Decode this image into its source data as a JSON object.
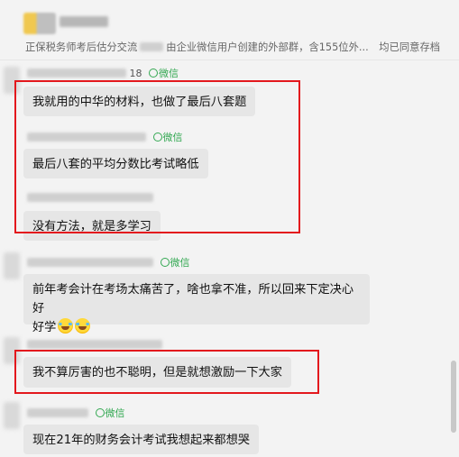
{
  "header": {
    "subtitle_prefix": "正保税务师考后估分交流",
    "subtitle_suffix": "由企业微信用户创建的外部群，含155位外...",
    "consent": "均已同意存档"
  },
  "wechat_tag": "微信",
  "messages": [
    {
      "sender_suffix": "18",
      "text": "我就用的中华的材料，也做了最后八套题"
    },
    {
      "sender_suffix": "",
      "text": "最后八套的平均分数比考试略低"
    },
    {
      "sender_suffix": "",
      "text": "没有方法，就是多学习"
    },
    {
      "sender_suffix": "",
      "text_line1": "前年考会计在考场太痛苦了，啥也拿不准，所以回来下定决心好",
      "text_line2": "好学"
    },
    {
      "sender_suffix": "",
      "text": "我不算厉害的也不聪明，但是就想激励一下大家"
    },
    {
      "sender_suffix": "",
      "text": "现在21年的财务会计考试我想起来都想哭"
    }
  ],
  "highlight_color": "#e3181d"
}
